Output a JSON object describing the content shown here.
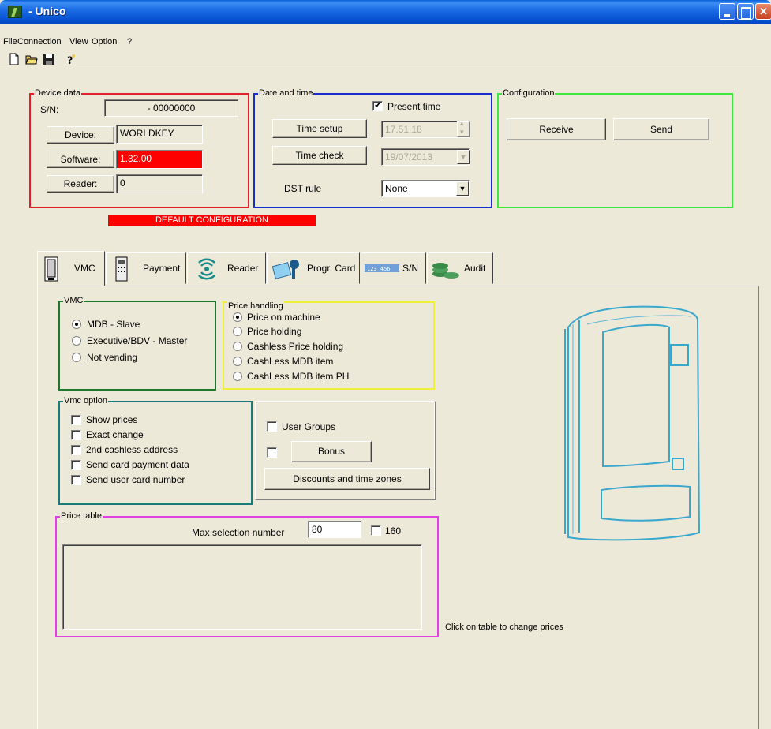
{
  "window": {
    "title": "- Unico",
    "min_glyph": "",
    "max_glyph": "",
    "close_glyph": "✕"
  },
  "menu": {
    "file": "File",
    "connection": "Connection",
    "view": "View",
    "option": "Option",
    "help": "?"
  },
  "toolbar": {
    "new_icon": "new-file-icon",
    "open_icon": "open-folder-icon",
    "save_icon": "save-disk-icon",
    "help_icon": "help-question-icon"
  },
  "device_data": {
    "legend": "Device data",
    "sn_label": "S/N:",
    "sn_value": "- 00000000",
    "device_button": "Device:",
    "device_value": "WORLDKEY",
    "software_button": "Software:",
    "software_value": "1.32.00",
    "reader_button": "Reader:",
    "reader_value": "0",
    "software_highlight": "#ff0000"
  },
  "date_time": {
    "legend": "Date and time",
    "present_time_label": "Present time",
    "present_time_checked": true,
    "time_setup_button": "Time setup",
    "time_value": "17.51.18",
    "time_check_button": "Time check",
    "date_value": "19/07/2013",
    "dst_label": "DST rule",
    "dst_value": "None"
  },
  "configuration": {
    "legend": "Configuration",
    "receive_button": "Receive",
    "send_button": "Send"
  },
  "status_banner": "DEFAULT CONFIGURATION",
  "tabs": [
    {
      "label": "VMC",
      "icon": "vending-machine-icon"
    },
    {
      "label": "Payment",
      "icon": "payment-terminal-icon"
    },
    {
      "label": "Reader",
      "icon": "contactless-reader-icon"
    },
    {
      "label": "Progr. Card",
      "icon": "key-card-icon"
    },
    {
      "label": "S/N",
      "icon": "serial-number-icon"
    },
    {
      "label": "Audit",
      "icon": "audit-coins-icon"
    }
  ],
  "vmc_group": {
    "legend": "VMC",
    "options": [
      "MDB - Slave",
      "Executive/BDV - Master",
      "Not vending"
    ],
    "selected": 0
  },
  "price_handling": {
    "legend": "Price handling",
    "options": [
      "Price on machine",
      "Price holding",
      "Cashless Price holding",
      "CashLess MDB item",
      "CashLess MDB item PH"
    ],
    "selected": 0
  },
  "vmc_option": {
    "legend": "Vmc option",
    "options": [
      "Show prices",
      "Exact change",
      "2nd cashless address",
      "Send card payment data",
      "Send user card number"
    ]
  },
  "user_box": {
    "user_groups_label": "User Groups",
    "bonus_button": "Bonus",
    "discounts_button": "Discounts and time zones"
  },
  "price_table": {
    "legend": "Price table",
    "max_selection_label": "Max selection number",
    "max_selection_value": "80",
    "option_160_label": "160",
    "hint": "Click on table to change prices"
  },
  "colors": {
    "device_border": "#e0202c",
    "datetime_border": "#1a2ccc",
    "config_border": "#3ee63e",
    "vmc_border": "#1a7a2a",
    "price_handling_border": "#f0f03a",
    "vmc_option_border": "#1a7a7a",
    "price_table_border": "#e040e0"
  }
}
